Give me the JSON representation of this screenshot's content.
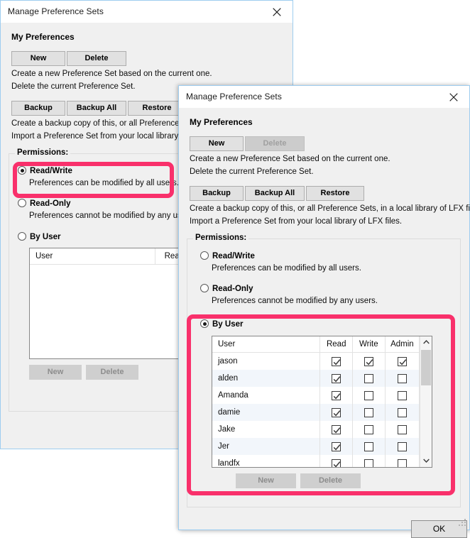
{
  "colors": {
    "highlight_pink": "#f9306b",
    "window_border": "#9ecdf0",
    "dialog_face": "#f0f0f0",
    "button_face": "#e1e1e1",
    "alt_row": "#f2f6fb"
  },
  "window_base": {
    "title": "Manage Preference Sets",
    "close_icon": "close-icon",
    "section_title": "My Preferences",
    "buttons": {
      "new": "New",
      "delete": "Delete",
      "backup": "Backup",
      "backup_all": "Backup All",
      "restore": "Restore"
    },
    "hints": {
      "new": "Create a new Preference Set based on the current one.",
      "delete": "Delete the current Preference Set.",
      "backup": "Create a backup copy of this, or all Preference Se",
      "restore": "Import a Preference Set from your local library of L"
    },
    "permissions": {
      "group_label": "Permissions:",
      "options": [
        {
          "label": "Read/Write",
          "description": "Preferences can be modified by all users.",
          "selected": true,
          "highlighted": true
        },
        {
          "label": "Read-Only",
          "description": "Preferences cannot be modified by any users",
          "selected": false,
          "highlighted": false
        },
        {
          "label": "By User",
          "description": "",
          "selected": false,
          "highlighted": false
        }
      ],
      "table": {
        "columns": [
          "User",
          "Read"
        ],
        "rows": []
      },
      "list_buttons": {
        "new": "New",
        "delete": "Delete"
      }
    }
  },
  "window_front": {
    "title": "Manage Preference Sets",
    "close_icon": "close-icon",
    "section_title": "My Preferences",
    "buttons": {
      "new": "New",
      "delete": "Delete",
      "backup": "Backup",
      "backup_all": "Backup All",
      "restore": "Restore"
    },
    "hints": {
      "new": "Create a new Preference Set based on the current one.",
      "delete": "Delete the current Preference Set.",
      "backup": "Create a backup copy of this, or all Preference Sets, in a local library of LFX files.",
      "restore": "Import a Preference Set from your local library of LFX files."
    },
    "permissions": {
      "group_label": "Permissions:",
      "options": [
        {
          "label": "Read/Write",
          "description": "Preferences can be modified by all users.",
          "selected": false,
          "highlighted": false
        },
        {
          "label": "Read-Only",
          "description": "Preferences cannot be modified by any users.",
          "selected": false,
          "highlighted": false
        },
        {
          "label": "By User",
          "description": "",
          "selected": true,
          "highlighted": true
        }
      ],
      "table": {
        "columns": [
          "User",
          "Read",
          "Write",
          "Admin"
        ],
        "rows": [
          {
            "user": "jason",
            "read": true,
            "write": true,
            "admin": true
          },
          {
            "user": "alden",
            "read": true,
            "write": false,
            "admin": false
          },
          {
            "user": "Amanda",
            "read": true,
            "write": false,
            "admin": false
          },
          {
            "user": "damie",
            "read": true,
            "write": false,
            "admin": false
          },
          {
            "user": "Jake",
            "read": true,
            "write": false,
            "admin": false
          },
          {
            "user": "Jer",
            "read": true,
            "write": false,
            "admin": false
          },
          {
            "user": "landfx",
            "read": true,
            "write": false,
            "admin": false
          }
        ]
      },
      "list_buttons": {
        "new": "New",
        "delete": "Delete"
      },
      "scrollbar": {
        "up_icon": "chevron-up-icon",
        "down_icon": "chevron-down-icon"
      }
    },
    "ok_button": "OK"
  }
}
